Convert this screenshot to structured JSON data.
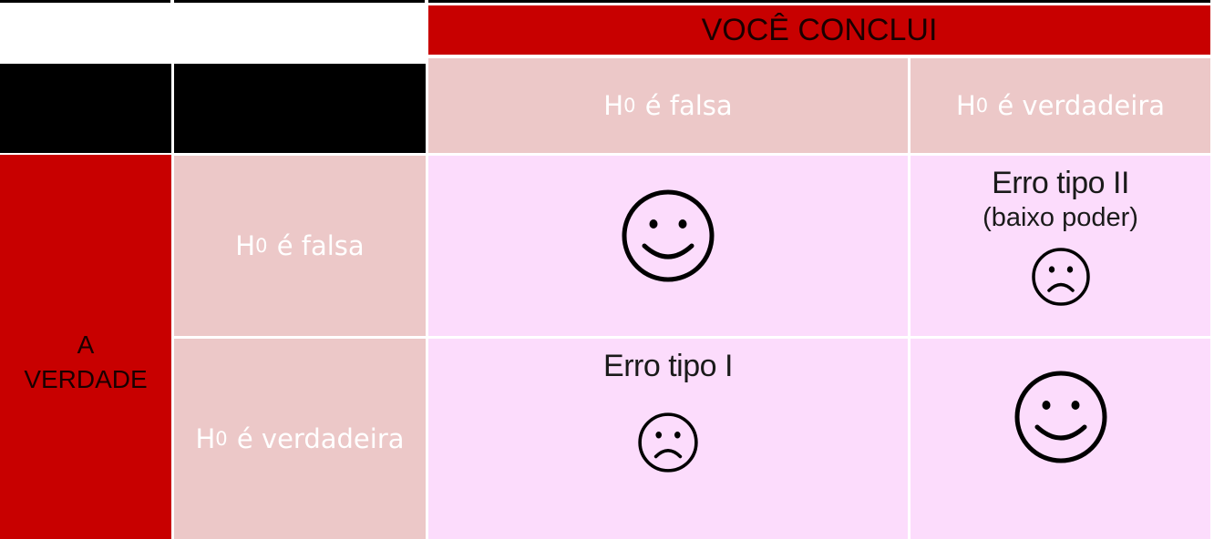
{
  "header": {
    "conclude": "VOCÊ CONCLUI"
  },
  "truth": {
    "line1": "A",
    "line2": "VERDADE"
  },
  "columns": [
    {
      "symbol": "H",
      "subscript": "0",
      "text": " é falsa"
    },
    {
      "symbol": "H",
      "subscript": "0",
      "text": " é verdadeira"
    }
  ],
  "rows": [
    {
      "symbol": "H",
      "subscript": "0",
      "text": " é falsa"
    },
    {
      "symbol": "H",
      "subscript": "0",
      "text": " é verdadeira"
    }
  ],
  "outcomes": {
    "false_false": {
      "face": "smiley-face-icon"
    },
    "false_true": {
      "label": "Erro tipo II",
      "note": "(baixo poder)",
      "face": "sad-face-icon"
    },
    "true_false": {
      "label": "Erro tipo I",
      "face": "sad-face-icon"
    },
    "true_true": {
      "face": "smiley-face-icon"
    }
  },
  "colors": {
    "red": "#c80000",
    "header_pink": "#ecc8c8",
    "cell_pink": "#fcdcfc",
    "black": "#000000"
  }
}
